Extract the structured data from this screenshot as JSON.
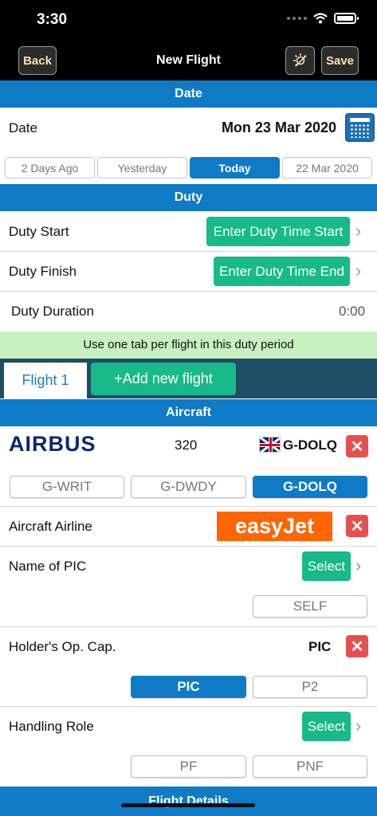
{
  "status_bar": {
    "time": "3:30"
  },
  "nav": {
    "back_label": "Back",
    "title": "New Flight",
    "save_label": "Save",
    "night_icon": "day-night-icon"
  },
  "date_section": {
    "header": "Date",
    "label": "Date",
    "value": "Mon 23 Mar 2020",
    "quick_buttons": [
      {
        "label": "2 Days Ago",
        "active": false
      },
      {
        "label": "Yesterday",
        "active": false
      },
      {
        "label": "Today",
        "active": true
      },
      {
        "label": "22 Mar 2020",
        "active": false
      }
    ]
  },
  "duty_section": {
    "header": "Duty",
    "start_label": "Duty Start",
    "start_button": "Enter Duty Time Start",
    "finish_label": "Duty Finish",
    "finish_button": "Enter Duty Time End",
    "duration_label": "Duty Duration",
    "duration_value": "0:00"
  },
  "notice": "Use one tab per flight in this duty period",
  "flight_tabs": {
    "current_tab": "Flight 1",
    "add_label": "+Add new flight"
  },
  "aircraft_section": {
    "header": "Aircraft",
    "manufacturer_logo": "AIRBUS",
    "type": "320",
    "registration": "G-DOLQ",
    "recent_registrations": [
      {
        "label": "G-WRIT",
        "active": false
      },
      {
        "label": "G-DWDY",
        "active": false
      },
      {
        "label": "G-DOLQ",
        "active": true
      }
    ],
    "airline_label": "Aircraft Airline",
    "airline_logo": "easyJet",
    "pic_label": "Name of PIC",
    "pic_select": "Select",
    "pic_self": "SELF",
    "capacity_label": "Holder's Op. Cap.",
    "capacity_value": "PIC",
    "capacity_options": [
      {
        "label": "PIC",
        "active": true
      },
      {
        "label": "P2",
        "active": false
      }
    ],
    "handling_label": "Handling Role",
    "handling_select": "Select",
    "handling_options": [
      {
        "label": "PF",
        "active": false
      },
      {
        "label": "PNF",
        "active": false
      }
    ]
  },
  "flight_details_section": {
    "header": "Flight Details"
  },
  "colors": {
    "header_blue": "#0f7bc6",
    "action_green": "#18b98a",
    "delete_red": "#e45050",
    "notice_green": "#c8f0c0",
    "tab_bar": "#1d4e66",
    "easyjet_orange": "#ff6600"
  }
}
